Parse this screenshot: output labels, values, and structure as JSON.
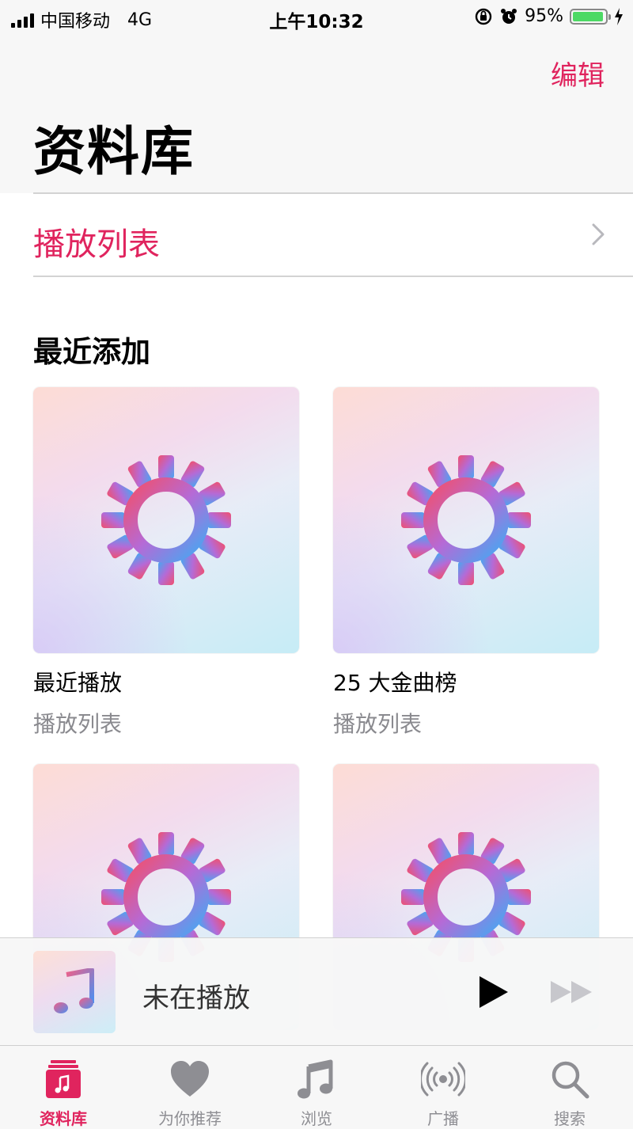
{
  "status_bar": {
    "carrier": "中国移动",
    "network": "4G",
    "time": "上午10:32",
    "battery_percent": "95%",
    "battery_level": 0.95
  },
  "header": {
    "edit_label": "编辑",
    "title": "资料库"
  },
  "playlist_row": {
    "label": "播放列表",
    "icon": "chevron-right-icon"
  },
  "recently_added": {
    "title": "最近添加",
    "items": [
      {
        "name": "最近播放",
        "subtitle": "播放列表",
        "icon": "gear-icon"
      },
      {
        "name": "25 大金曲榜",
        "subtitle": "播放列表",
        "icon": "gear-icon"
      },
      {
        "name": "",
        "subtitle": "",
        "icon": "gear-icon"
      },
      {
        "name": "",
        "subtitle": "",
        "icon": "gear-icon"
      }
    ]
  },
  "mini_player": {
    "title": "未在播放",
    "art_icon": "music-note-icon",
    "play_icon": "play-icon",
    "forward_icon": "fast-forward-icon"
  },
  "tab_bar": {
    "tabs": [
      {
        "label": "资料库",
        "icon": "library-icon",
        "active": true
      },
      {
        "label": "为你推荐",
        "icon": "heart-icon",
        "active": false
      },
      {
        "label": "浏览",
        "icon": "music-note-icon",
        "active": false
      },
      {
        "label": "广播",
        "icon": "radio-icon",
        "active": false
      },
      {
        "label": "搜索",
        "icon": "search-icon",
        "active": false
      }
    ]
  },
  "colors": {
    "accent": "#e0245e",
    "battery": "#4cd964",
    "secondary_text": "#8a8a8f"
  }
}
